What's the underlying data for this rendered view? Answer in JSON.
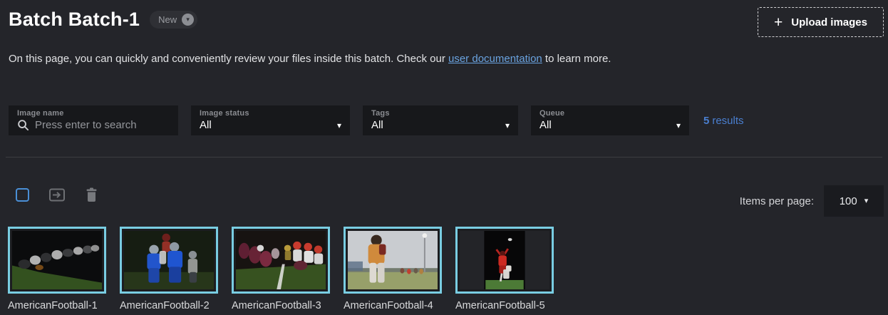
{
  "header": {
    "title": "Batch Batch-1",
    "badge_label": "New",
    "upload_button_label": "Upload images"
  },
  "description": {
    "text_before_link": "On this page, you can quickly and conveniently review your files inside this batch. Check our ",
    "link_text": "user documentation",
    "text_after_link": " to learn more."
  },
  "filters": {
    "image_name": {
      "label": "Image name",
      "placeholder": "Press enter to search"
    },
    "image_status": {
      "label": "Image status",
      "value": "All"
    },
    "tags": {
      "label": "Tags",
      "value": "All"
    },
    "queue": {
      "label": "Queue",
      "value": "All"
    },
    "results_count": "5",
    "results_label": "results"
  },
  "toolbar": {
    "items_per_page_label": "Items per page:",
    "items_per_page_value": "100"
  },
  "gallery": {
    "items": [
      {
        "name": "AmericanFootball-1"
      },
      {
        "name": "AmericanFootball-2"
      },
      {
        "name": "AmericanFootball-3"
      },
      {
        "name": "AmericanFootball-4"
      },
      {
        "name": "AmericanFootball-5"
      }
    ]
  },
  "icons": {
    "plus": "+",
    "chevron_down": "▾",
    "search": "magnifier",
    "move_to": "move-to-queue",
    "trash": "delete"
  },
  "colors": {
    "background": "#24252a",
    "field_background": "#17181b",
    "accent_blue": "#4a8fd6",
    "link_blue": "#6aa3e0",
    "results_blue": "#4a7fd0",
    "selection_cyan": "#79cde2"
  }
}
